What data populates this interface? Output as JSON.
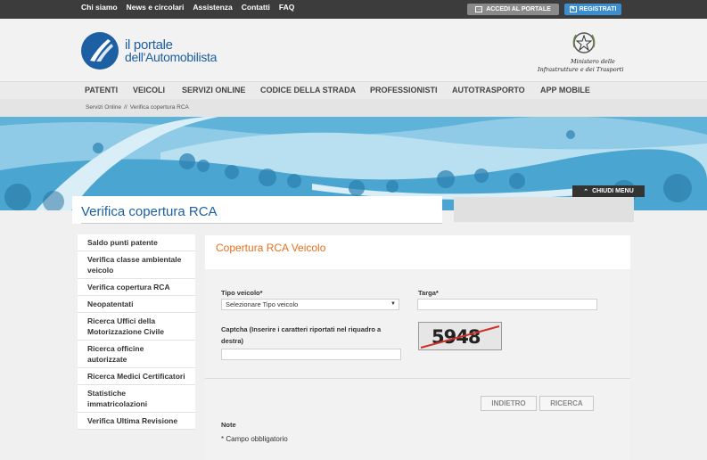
{
  "topbar": {
    "links": [
      "Chi siamo",
      "News e circolari",
      "Assistenza",
      "Contatti",
      "FAQ"
    ],
    "login_label": "ACCEDI AL PORTALE",
    "register_label": "REGISTRATI"
  },
  "header": {
    "logo_line1": "il portale",
    "logo_line2": "dell'Automobilista",
    "ministry_line1": "Ministero delle",
    "ministry_line2": "Infrastrutture e dei Trasporti"
  },
  "nav": {
    "items": [
      "PATENTI",
      "VEICOLI",
      "SERVIZI ONLINE",
      "CODICE DELLA STRADA",
      "PROFESSIONISTI",
      "AUTOTRASPORTO",
      "APP MOBILE"
    ]
  },
  "breadcrumb": {
    "home": "Servizi Online",
    "separator": "//",
    "current": "Verifica copertura RCA"
  },
  "banner": {
    "close_menu_label": "CHIUDI MENU"
  },
  "page": {
    "title": "Verifica copertura RCA"
  },
  "sidebar": {
    "items": [
      "Saldo punti patente",
      "Verifica classe ambientale veicolo",
      "Verifica copertura RCA",
      "Neopatentati",
      "Ricerca Uffici della Motorizzazione Civile",
      "Ricerca officine autorizzate",
      "Ricerca Medici Certificatori",
      "Statistiche immatricolazioni",
      "Verifica Ultima Revisione"
    ]
  },
  "form": {
    "title": "Copertura RCA Veicolo",
    "vehicle_type_label": "Tipo veicolo*",
    "vehicle_type_value": "Selezionare Tipo veicolo",
    "plate_label": "Targa*",
    "plate_value": "",
    "captcha_label": "Captcha (Inserire i caratteri riportati nel riquadro a destra)",
    "captcha_value": "",
    "captcha_text": "5948",
    "back_button": "INDIETRO",
    "search_button": "RICERCA",
    "note_title": "Note",
    "note_text": "* Campo obbligatorio"
  },
  "colors": {
    "brand_blue": "#1d5fa3",
    "accent_orange": "#e8701e",
    "topbar": "#3c3c3c",
    "register_blue": "#3b8fd1"
  }
}
